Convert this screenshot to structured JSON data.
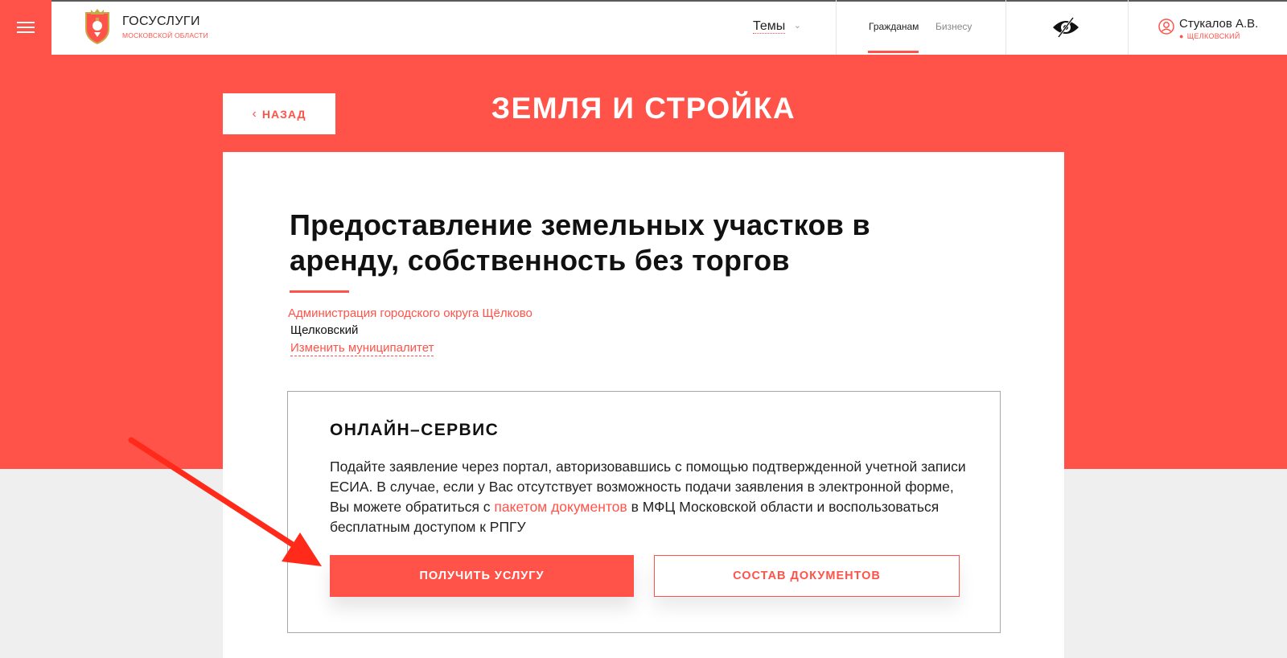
{
  "header": {
    "logo_title": "ГОСУСЛУГИ",
    "logo_subtitle": "МОСКОВСКОЙ ОБЛАСТИ",
    "themes_label": "Темы",
    "tabs": [
      {
        "label": "Гражданам",
        "active": true
      },
      {
        "label": "Бизнесу",
        "active": false
      }
    ],
    "user_name": "Стукалов А.В.",
    "user_location": "ЩЕЛКОВСКИЙ"
  },
  "banner": {
    "back_label": "НАЗАД",
    "page_title": "ЗЕМЛЯ И СТРОЙКА"
  },
  "service": {
    "title": "Предоставление земельных участков в аренду, собственность без торгов",
    "agency": "Администрация городского округа Щёлково",
    "municipality": "Щелковский",
    "change_municipality": "Изменить муниципалитет"
  },
  "online": {
    "title": "ОНЛАЙН–СЕРВИС",
    "text_before": "Подайте заявление через портал, авторизовавшись с помощью подтвержденной учетной записи ЕСИА. В случае, если у Вас отсутствует возможность подачи заявления в электронной форме, Вы можете обратиться с ",
    "text_link": "пакетом документов",
    "text_after": " в МФЦ Московской области и воспользоваться бесплатным доступом к РПГУ",
    "primary_button": "ПОЛУЧИТЬ УСЛУГУ",
    "secondary_button": "СОСТАВ ДОКУМЕНТОВ"
  },
  "icons": {
    "menu": "hamburger-menu-icon",
    "crest": "moscow-region-crest",
    "chevron": "chevron-down-icon",
    "eye": "visually-impaired-eye-icon",
    "user": "user-circle-icon",
    "pin": "location-pin-icon",
    "back": "chevron-left-icon",
    "arrow": "annotation-arrow"
  },
  "colors": {
    "accent": "#ff5349",
    "page_background": "#efefef",
    "text": "#111111",
    "annotation": "#ff2a1a"
  }
}
